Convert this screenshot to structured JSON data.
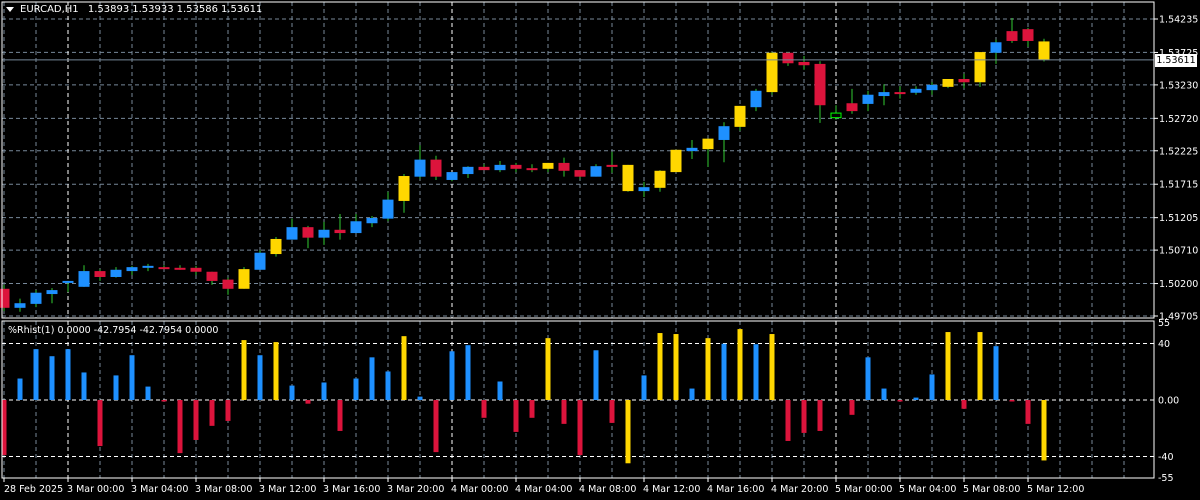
{
  "header": {
    "symbol": "EURCAD,H1",
    "open": "1.53893",
    "high": "1.53933",
    "low": "1.53586",
    "close": "1.53611"
  },
  "indicator_header": {
    "name": "%Rhist(1)",
    "values": "0.0000 -42.7954 -42.7954 0.0000"
  },
  "current_price_label": "1.53611",
  "colors": {
    "background": "#000000",
    "grid": "#778899",
    "wick": "#32CD32",
    "bull": "#1E90FF",
    "bear": "#DC143C",
    "extreme": "#FFD700",
    "neutral": "#00FF00"
  },
  "chart_data": [
    {
      "type": "candlestick",
      "title": "EURCAD,H1",
      "ylim": [
        1.49705,
        1.54235
      ],
      "grid": true,
      "y_tick_labels": [
        "1.54235",
        "1.53725",
        "1.53230",
        "1.52720",
        "1.52225",
        "1.51715",
        "1.51205",
        "1.50710",
        "1.50200",
        "1.49705"
      ],
      "x_tick_labels": [
        "28 Feb 2025",
        "3 Mar 00:00",
        "3 Mar 04:00",
        "3 Mar 08:00",
        "3 Mar 12:00",
        "3 Mar 16:00",
        "3 Mar 20:00",
        "4 Mar 00:00",
        "4 Mar 04:00",
        "4 Mar 08:00",
        "4 Mar 12:00",
        "4 Mar 16:00",
        "4 Mar 20:00",
        "5 Mar 00:00",
        "5 Mar 04:00",
        "5 Mar 08:00",
        "5 Mar 12:00"
      ],
      "x_tick_bar_step": 4,
      "period_separator_bars": [
        4,
        28,
        52
      ],
      "current_price": 1.53611,
      "ohlc": [
        [
          1.5012,
          1.5018,
          1.4978,
          1.4983
        ],
        [
          1.4983,
          1.4997,
          1.4977,
          1.499
        ],
        [
          1.4989,
          1.501,
          1.4984,
          1.5006
        ],
        [
          1.5004,
          1.5013,
          1.499,
          1.501
        ],
        [
          1.5021,
          1.5024,
          1.5007,
          1.5024
        ],
        [
          1.5015,
          1.5048,
          1.5015,
          1.5039
        ],
        [
          1.5039,
          1.5042,
          1.5024,
          1.503
        ],
        [
          1.503,
          1.5045,
          1.5029,
          1.5041
        ],
        [
          1.5039,
          1.5047,
          1.5033,
          1.5045
        ],
        [
          1.5044,
          1.505,
          1.5039,
          1.5047
        ],
        [
          1.5045,
          1.5048,
          1.5042,
          1.5042
        ],
        [
          1.5044,
          1.5048,
          1.5041,
          1.5041
        ],
        [
          1.5044,
          1.5047,
          1.5033,
          1.5038
        ],
        [
          1.5038,
          1.5038,
          1.5018,
          1.5024
        ],
        [
          1.5026,
          1.5029,
          1.5003,
          1.5012
        ],
        [
          1.5012,
          1.5045,
          1.5012,
          1.5042
        ],
        [
          1.5041,
          1.5071,
          1.5041,
          1.5067
        ],
        [
          1.5065,
          1.5091,
          1.5061,
          1.5088
        ],
        [
          1.5087,
          1.5119,
          1.5087,
          1.5106
        ],
        [
          1.5106,
          1.5108,
          1.5074,
          1.509
        ],
        [
          1.509,
          1.5114,
          1.5079,
          1.5102
        ],
        [
          1.5102,
          1.5126,
          1.5087,
          1.5097
        ],
        [
          1.5097,
          1.5126,
          1.5097,
          1.5115
        ],
        [
          1.5112,
          1.5123,
          1.5106,
          1.512
        ],
        [
          1.5119,
          1.516,
          1.5115,
          1.5148
        ],
        [
          1.5146,
          1.5187,
          1.5128,
          1.5184
        ],
        [
          1.5183,
          1.5231,
          1.518,
          1.5209
        ],
        [
          1.5209,
          1.5215,
          1.5178,
          1.5183
        ],
        [
          1.5178,
          1.519,
          1.5176,
          1.519
        ],
        [
          1.5187,
          1.5199,
          1.5181,
          1.5198
        ],
        [
          1.5198,
          1.5202,
          1.5193,
          1.5193
        ],
        [
          1.5193,
          1.5207,
          1.519,
          1.5201
        ],
        [
          1.5201,
          1.5204,
          1.519,
          1.5195
        ],
        [
          1.5196,
          1.5202,
          1.519,
          1.5195
        ],
        [
          1.5195,
          1.5204,
          1.519,
          1.5204
        ],
        [
          1.5204,
          1.5212,
          1.5183,
          1.5192
        ],
        [
          1.5193,
          1.5193,
          1.518,
          1.5183
        ],
        [
          1.5183,
          1.5202,
          1.5183,
          1.5199
        ],
        [
          1.5201,
          1.5221,
          1.5189,
          1.5198
        ],
        [
          1.5201,
          1.5201,
          1.516,
          1.5161
        ],
        [
          1.5161,
          1.5175,
          1.5152,
          1.5167
        ],
        [
          1.5166,
          1.5193,
          1.516,
          1.5192
        ],
        [
          1.519,
          1.5224,
          1.519,
          1.5224
        ],
        [
          1.5222,
          1.5239,
          1.521,
          1.5227
        ],
        [
          1.5225,
          1.5241,
          1.5198,
          1.5241
        ],
        [
          1.5239,
          1.5266,
          1.5205,
          1.526
        ],
        [
          1.5259,
          1.5291,
          1.5253,
          1.5291
        ],
        [
          1.5289,
          1.5317,
          1.5283,
          1.5314
        ],
        [
          1.5312,
          1.5373,
          1.5308,
          1.5372
        ],
        [
          1.5372,
          1.5373,
          1.5352,
          1.5356
        ],
        [
          1.5358,
          1.5367,
          1.5346,
          1.5353
        ],
        [
          1.5355,
          1.5359,
          1.5265,
          1.5292
        ],
        [
          1.5273,
          1.5292,
          1.527,
          1.528
        ],
        [
          1.5295,
          1.5317,
          1.5279,
          1.5283
        ],
        [
          1.5294,
          1.5314,
          1.5283,
          1.5308
        ],
        [
          1.5306,
          1.5324,
          1.5292,
          1.5312
        ],
        [
          1.5312,
          1.5321,
          1.5302,
          1.5309
        ],
        [
          1.5311,
          1.5321,
          1.5308,
          1.5317
        ],
        [
          1.5315,
          1.5327,
          1.5308,
          1.5323
        ],
        [
          1.532,
          1.5332,
          1.5318,
          1.5332
        ],
        [
          1.5332,
          1.534,
          1.5318,
          1.5327
        ],
        [
          1.5327,
          1.5373,
          1.532,
          1.5373
        ],
        [
          1.5372,
          1.5392,
          1.5355,
          1.5388
        ],
        [
          1.5405,
          1.5425,
          1.5387,
          1.539
        ],
        [
          1.5408,
          1.541,
          1.5381,
          1.539
        ],
        [
          1.53893,
          1.53933,
          1.53586,
          1.53611
        ]
      ]
    },
    {
      "type": "bar",
      "title": "%Rhist(1)",
      "ylim": [
        -55,
        55
      ],
      "y_tick_labels": [
        "55",
        "40",
        "0.00",
        "-40",
        "-55"
      ],
      "y_tick_values": [
        55,
        40,
        0,
        -40,
        -55
      ],
      "levels": [
        40,
        0,
        -40
      ],
      "extreme_threshold": 40,
      "values": [
        -39,
        15.2,
        36,
        31,
        36,
        19.5,
        -32.6,
        17.4,
        31.7,
        9.5,
        -1,
        -37.6,
        -28.3,
        -18.3,
        -14.8,
        42.4,
        31.7,
        41,
        10.2,
        -2.6,
        12.4,
        -21.9,
        15.2,
        30.2,
        20.2,
        45.2,
        2.4,
        -36.9,
        34.5,
        38.8,
        -12.6,
        13.1,
        -22.6,
        -12.6,
        43.8,
        -16.9,
        -39,
        35.2,
        -16.2,
        -44.8,
        17.4,
        47.4,
        46.7,
        8.1,
        43.8,
        39.8,
        50.2,
        39.5,
        46.7,
        -29,
        -23.3,
        -21.9,
        0,
        -10.5,
        30.2,
        8.1,
        -1,
        1.7,
        18.1,
        48.1,
        -6.2,
        48.1,
        38.1,
        -1,
        -16.9,
        -42.7954
      ]
    }
  ]
}
